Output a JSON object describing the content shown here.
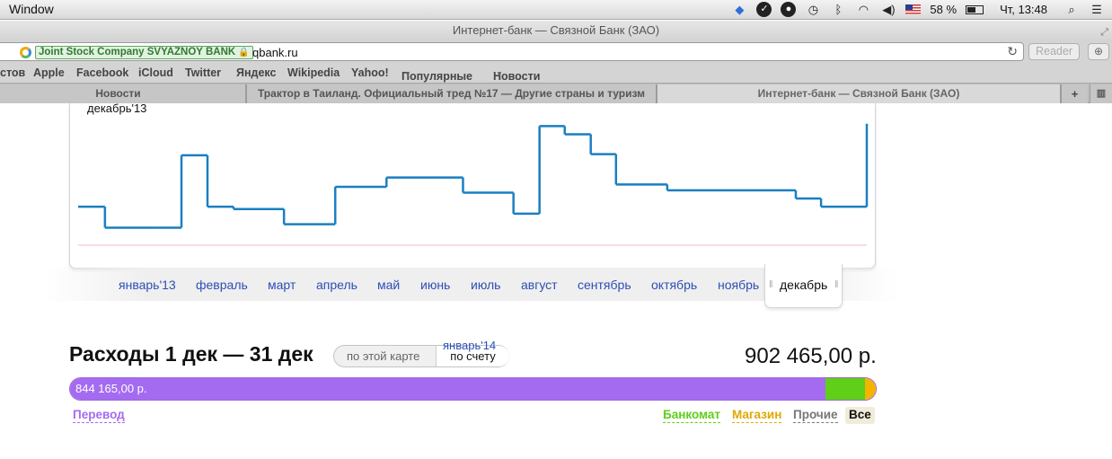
{
  "menubar": {
    "app_menu": "Window",
    "battery_percent": "58 %",
    "clock": "Чт, 13:48",
    "icons": [
      "dropbox-icon",
      "check-icon",
      "owl-icon",
      "time-machine-icon",
      "bluetooth-icon",
      "wifi-icon",
      "volume-icon",
      "flag-us-icon",
      "battery-icon",
      "spotlight-icon",
      "menu-list-icon"
    ]
  },
  "browser": {
    "window_title": "Интернет-банк — Связной Банк (ЗАО)",
    "ev_badge": "Joint Stock Company SVYAZNOY BANK",
    "url": "qbank.ru",
    "reader_label": "Reader",
    "bookmarks": [
      "стов",
      "Apple",
      "Facebook",
      "iCloud",
      "Twitter",
      "Яндекс",
      "Wikipedia",
      "Yahoo!",
      "Популярные",
      "Новости"
    ],
    "tabs": [
      {
        "label": "Новости",
        "active": false
      },
      {
        "label": "Трактор в Таиланд. Официальный тред №17 — Другие страны и туризм",
        "active": false
      },
      {
        "label": "Интернет-банк — Связной Банк (ЗАО)",
        "active": true
      }
    ]
  },
  "chart": {
    "period_label": "декабрь'13",
    "line_color": "#1a7fc1",
    "baseline_color": "#f0b8c0"
  },
  "chart_data": {
    "type": "line",
    "step": true,
    "title": "",
    "xlabel": "",
    "ylabel": "",
    "y_axis_visible": false,
    "x_range": [
      0,
      100
    ],
    "y_range": [
      0,
      100
    ],
    "x": [
      0,
      3.4,
      9.8,
      13.1,
      16.4,
      19.7,
      26.1,
      32.6,
      39.1,
      45.5,
      48.8,
      55.2,
      58.5,
      61.7,
      65.0,
      68.2,
      74.7,
      84.4,
      91.0,
      94.2,
      100
    ],
    "values": [
      33,
      15,
      15,
      77,
      33,
      31,
      18,
      50,
      58,
      58,
      45,
      27,
      102,
      95,
      78,
      52,
      47,
      47,
      40,
      33,
      104
    ]
  },
  "months": {
    "items": [
      "январь'13",
      "февраль",
      "март",
      "апрель",
      "май",
      "июнь",
      "июль",
      "август",
      "сентябрь",
      "октябрь",
      "ноябрь"
    ],
    "selected": "декабрь",
    "next": "январь'14"
  },
  "expenses": {
    "title": "Расходы 1 дек — 31 дек",
    "toggle_card": "по этой карте",
    "toggle_account": "по счету",
    "total": "902 465,00 р.",
    "bar_label": "844 165,00 р.",
    "segments": [
      {
        "name": "Перевод",
        "color": "#a46bf0",
        "value": 844165.0
      },
      {
        "name": "Банкомат",
        "color": "#5fcf17"
      },
      {
        "name": "Магазин",
        "color": "#f4b400"
      }
    ],
    "legend": {
      "transfer": "Перевод",
      "atm": "Банкомат",
      "shop": "Магазин",
      "other": "Прочие",
      "all": "Все"
    },
    "legend_colors": {
      "transfer": "#a46bf0",
      "atm": "#5fcf17",
      "shop": "#e0a800",
      "other": "#777777"
    }
  }
}
